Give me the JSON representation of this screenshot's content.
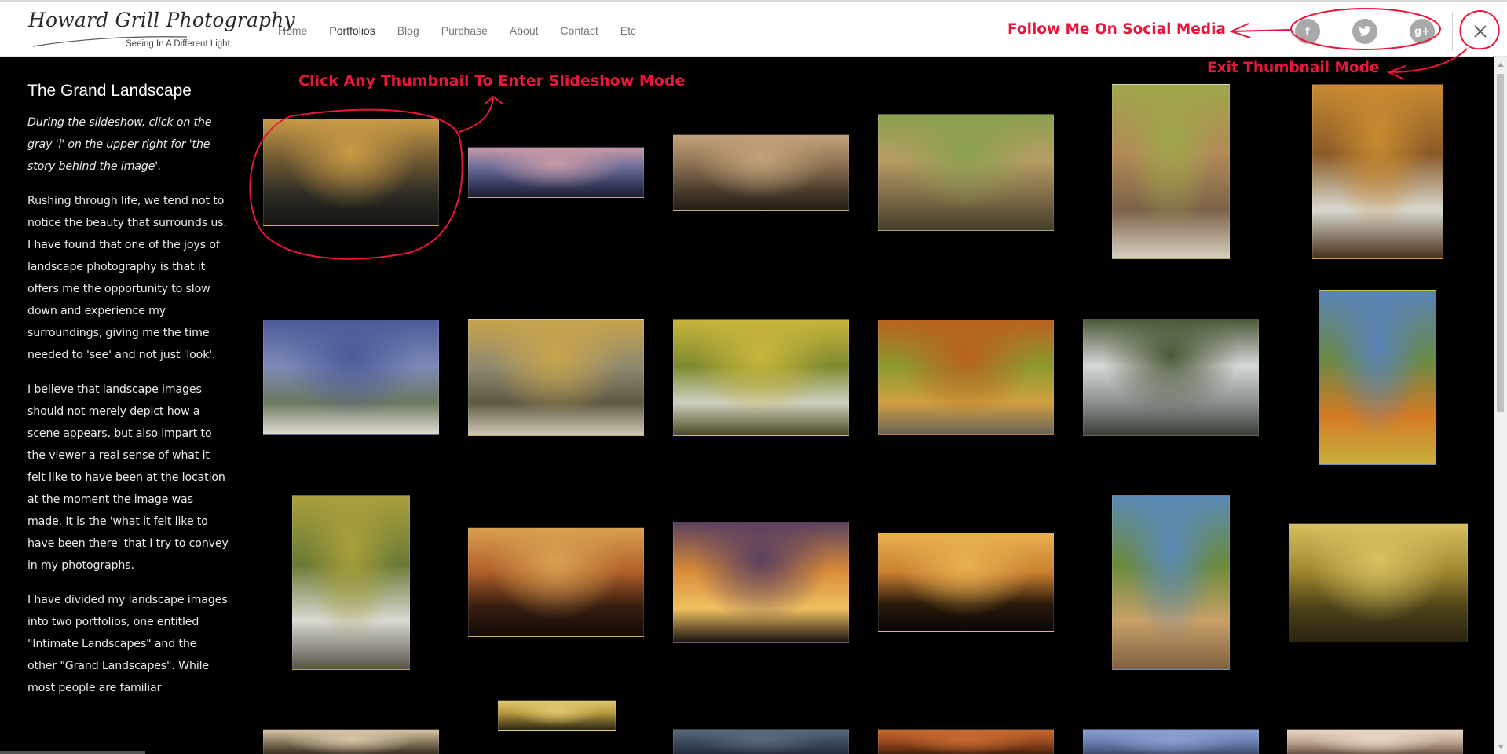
{
  "header": {
    "logo_text": "Howard Grill Photography",
    "tagline": "Seeing In A Different Light",
    "nav": [
      {
        "label": "Home"
      },
      {
        "label": "Portfolios",
        "active": true
      },
      {
        "label": "Blog"
      },
      {
        "label": "Purchase"
      },
      {
        "label": "About"
      },
      {
        "label": "Contact"
      },
      {
        "label": "Etc"
      }
    ],
    "social": [
      {
        "icon": "facebook-icon",
        "glyph": "f"
      },
      {
        "icon": "twitter-icon",
        "glyph": "t"
      },
      {
        "icon": "google-plus-icon",
        "glyph": "g+"
      }
    ],
    "close_icon": "close-icon"
  },
  "sidebar": {
    "title": "The Grand Landscape",
    "paragraphs": [
      "During the slideshow, click on the gray 'i' on the upper right for 'the story behind the image'.",
      "Rushing through life, we tend not to notice the beauty that surrounds us. I have found that one of the joys of landscape photography is that it offers me the opportunity to slow down and experience my surroundings, giving me the time needed to 'see' and not just 'look'.",
      "I believe that landscape images should not merely depict how a scene appears, but also impart to the viewer a real sense of what it felt like to have been at the location at the moment the image was made. It is the 'what it felt like to have been there' that I try to convey in my photographs.",
      "I have divided my landscape images into two portfolios, one entitled \"Intimate Landscapes\" and the other \"Grand Landscapes\". While most people are familiar"
    ]
  },
  "annotations": {
    "thumbnail_hint": "Click Any Thumbnail To Enter Slideshow Mode",
    "social_hint": "Follow Me On Social Media",
    "exit_hint": "Exit Thumbnail Mode"
  },
  "colors": {
    "annotation": "#e8173a",
    "background": "#000000",
    "header_bg": "#ffffff",
    "social_btn": "#a9a9a9"
  },
  "thumbnails": [
    {
      "scene": "mountain-sunrays",
      "colors": [
        "#c99a45",
        "#6a5632",
        "#2b2a24",
        "#151512"
      ]
    },
    {
      "scene": "purple-dusk-ridges",
      "colors": [
        "#c89aa6",
        "#6b6c98",
        "#3b4064",
        "#1c1d30"
      ]
    },
    {
      "scene": "sepia-ridges",
      "colors": [
        "#c2a27a",
        "#8a6f50",
        "#4d3f2e",
        "#221c16"
      ]
    },
    {
      "scene": "river-rocks",
      "colors": [
        "#8aa050",
        "#b79c63",
        "#7c6a46",
        "#463f2c"
      ]
    },
    {
      "scene": "gorge-stream",
      "colors": [
        "#9fa64a",
        "#b28a57",
        "#7b6248",
        "#d8d0c0"
      ]
    },
    {
      "scene": "autumn-waterfall",
      "colors": [
        "#c98b31",
        "#8a5a26",
        "#d9d9d0",
        "#4a301a"
      ]
    },
    {
      "scene": "lighthouse",
      "colors": [
        "#4d5a98",
        "#7d8ab8",
        "#6b7860",
        "#e0dcd2"
      ]
    },
    {
      "scene": "autumn-river-slabs",
      "colors": [
        "#c9a44c",
        "#8f8a70",
        "#5e5a44",
        "#cfc7b4"
      ]
    },
    {
      "scene": "yellow-cascade",
      "colors": [
        "#c9b63c",
        "#7e8a2e",
        "#cfd0c0",
        "#4c4a22"
      ]
    },
    {
      "scene": "fall-forest-river",
      "colors": [
        "#b9621e",
        "#8c9a2e",
        "#d0a040",
        "#6a6458"
      ]
    },
    {
      "scene": "snowy-river",
      "colors": [
        "#4c5a38",
        "#d4d8d8",
        "#8a9090",
        "#3a3e36"
      ]
    },
    {
      "scene": "valley-overlook",
      "colors": [
        "#5a82b8",
        "#6a8a46",
        "#d47a24",
        "#c8b03c"
      ]
    },
    {
      "scene": "forest-stream",
      "colors": [
        "#a9a03c",
        "#6a7a34",
        "#dadad2",
        "#56524a"
      ]
    },
    {
      "scene": "sea-stacks-sunset",
      "colors": [
        "#d9a050",
        "#b0602a",
        "#3a1e10",
        "#120a06"
      ]
    },
    {
      "scene": "sea-stacks-sunburst",
      "colors": [
        "#5a4060",
        "#d88a38",
        "#f0c060",
        "#1a1210"
      ]
    },
    {
      "scene": "cliff-silhouette",
      "colors": [
        "#e8b050",
        "#c98030",
        "#2a1a0a",
        "#0a0604"
      ]
    },
    {
      "scene": "shoreline-cliff",
      "colors": [
        "#5a8ab8",
        "#6a8a3c",
        "#c8a068",
        "#806040"
      ]
    },
    {
      "scene": "misty-pond-sun",
      "colors": [
        "#d8c060",
        "#a08830",
        "#4a4018",
        "#2a2410"
      ]
    },
    {
      "scene": "row4-a",
      "colors": [
        "#d8c8a8",
        "#8a7a60",
        "#4a4030",
        "#2a2418"
      ]
    },
    {
      "scene": "golden-mist",
      "colors": [
        "#e0c870",
        "#b89a40",
        "#6a5a28",
        "#2a2410"
      ]
    },
    {
      "scene": "row4-c",
      "colors": [
        "#5a6a7a",
        "#3a4a5a",
        "#2a3444",
        "#1a2030"
      ]
    },
    {
      "scene": "row4-d",
      "colors": [
        "#c86a30",
        "#9a4a20",
        "#5a2a10",
        "#2a1408"
      ]
    },
    {
      "scene": "row4-e",
      "colors": [
        "#8aa0d0",
        "#6a80b0",
        "#4a5a80",
        "#2a3450"
      ]
    },
    {
      "scene": "row4-f",
      "colors": [
        "#e8d8c8",
        "#c0a890",
        "#806858",
        "#403028"
      ]
    }
  ]
}
